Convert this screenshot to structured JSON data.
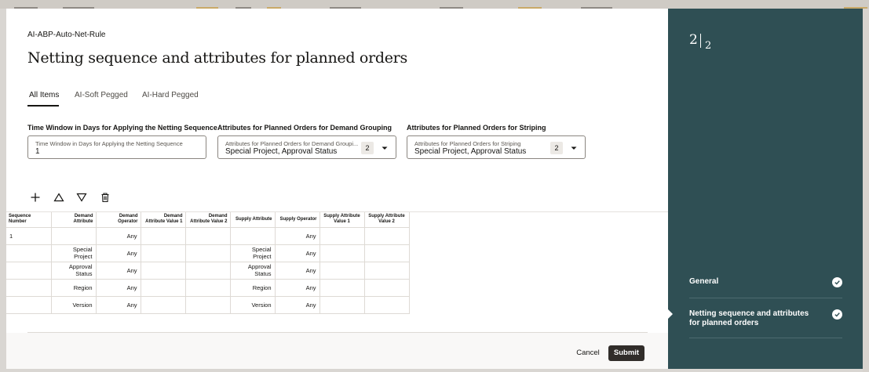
{
  "rule_name": "AI-ABP-Auto-Net-Rule",
  "page_title": "Netting sequence and attributes for planned orders",
  "tabs": [
    {
      "label": "All Items",
      "active": true
    },
    {
      "label": "AI-Soft Pegged",
      "active": false
    },
    {
      "label": "AI-Hard Pegged",
      "active": false
    }
  ],
  "fields": {
    "time_window": {
      "label": "Time Window in Days for Applying the Netting Sequence",
      "inner_label": "Time Window in Days for Applying the Netting Sequence",
      "value": "1"
    },
    "demand_grouping": {
      "label": "Attributes for Planned Orders for Demand Grouping",
      "inner_label": "Attributes for Planned Orders for Demand Groupi...",
      "value": "Special Project, Approval Status",
      "count": "2"
    },
    "striping": {
      "label": "Attributes for Planned Orders for Striping",
      "inner_label": "Attributes for Planned Orders for Striping",
      "value": "Special Project, Approval Status",
      "count": "2"
    }
  },
  "toolbar": {
    "add_icon": "plus-icon",
    "move_up_icon": "triangle-up-icon",
    "move_down_icon": "triangle-down-icon",
    "delete_icon": "trash-icon"
  },
  "grid": {
    "headers": [
      "Sequence Number",
      "Demand Attribute",
      "Demand Operator",
      "Demand Attribute Value 1",
      "Demand Attribute Value 2",
      "Supply Attribute",
      "Supply Operator",
      "Supply Attribute Value 1",
      "Supply Attribute Value 2"
    ],
    "rows": [
      [
        "1",
        "",
        "Any",
        "",
        "",
        "",
        "Any",
        "",
        ""
      ],
      [
        "",
        "Special Project",
        "Any",
        "",
        "",
        "Special Project",
        "Any",
        "",
        ""
      ],
      [
        "",
        "Approval Status",
        "Any",
        "",
        "",
        "Approval Status",
        "Any",
        "",
        ""
      ],
      [
        "",
        "Region",
        "Any",
        "",
        "",
        "Region",
        "Any",
        "",
        ""
      ],
      [
        "",
        "Version",
        "Any",
        "",
        "",
        "Version",
        "Any",
        "",
        ""
      ]
    ]
  },
  "footer": {
    "cancel_label": "Cancel",
    "submit_label": "Submit"
  },
  "sidebar": {
    "current_page": "2",
    "total_pages": "2",
    "steps": [
      {
        "label": "General",
        "complete": true
      },
      {
        "label": "Netting sequence and attributes for planned orders",
        "complete": true
      }
    ]
  },
  "colors": {
    "sidebar_bg": "#2f4f54",
    "primary_button": "#312d2a",
    "text": "#161513"
  }
}
